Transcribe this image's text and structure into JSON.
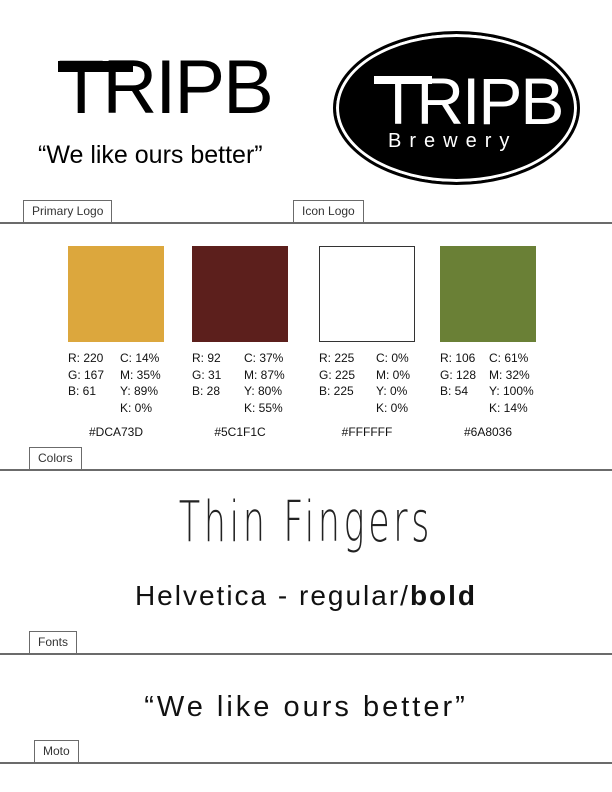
{
  "primary_logo": {
    "wordmark": "TRIPB",
    "tagline": "“We like ours better”"
  },
  "icon_logo": {
    "wordmark": "TRIPB",
    "subtitle": "Brewery"
  },
  "sections": {
    "primary_logo_label": "Primary Logo",
    "icon_logo_label": "Icon Logo",
    "colors_label": "Colors",
    "fonts_label": "Fonts",
    "moto_label": "Moto"
  },
  "colors": [
    {
      "hex": "#DCA73D",
      "r": "R: 220",
      "g": "G: 167",
      "b": "B: 61",
      "c": "C: 14%",
      "m": "M: 35%",
      "y": "Y: 89%",
      "k": "K: 0%"
    },
    {
      "hex": "#5C1F1C",
      "r": "R: 92",
      "g": "G: 31",
      "b": "B: 28",
      "c": "C: 37%",
      "m": "M: 87%",
      "y": "Y: 80%",
      "k": "K: 55%"
    },
    {
      "hex": "#FFFFFF",
      "r": "R: 225",
      "g": "G: 225",
      "b": "B: 225",
      "c": "C: 0%",
      "m": "M: 0%",
      "y": "Y: 0%",
      "k": "K: 0%"
    },
    {
      "hex": "#6A8036",
      "r": "R: 106",
      "g": "G: 128",
      "b": "B: 54",
      "c": "C: 61%",
      "m": "M: 32%",
      "y": "Y: 100%",
      "k": "K: 14%"
    }
  ],
  "fonts": {
    "display_font": "Thin Fingers",
    "body_font_prefix": "Helvetica - regular/",
    "body_font_bold": "bold"
  },
  "moto": {
    "text": "“We like ours better”"
  }
}
